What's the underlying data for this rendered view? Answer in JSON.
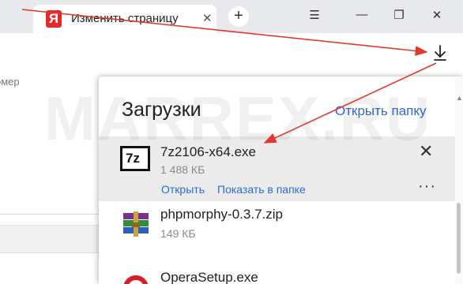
{
  "tab": {
    "title": "Изменить страницу",
    "logo_letter": "Я",
    "close_glyph": "✕"
  },
  "window": {
    "new_tab_glyph": "+",
    "menu_glyph": "☰",
    "minimize_glyph": "—",
    "restore_glyph": "❐",
    "close_glyph": "✕"
  },
  "page": {
    "left_text": "омер",
    "watermark": "MARREX.RU"
  },
  "downloads": {
    "title": "Загрузки",
    "open_folder": "Открыть папку",
    "items": [
      {
        "name": "7z2106-x64.exe",
        "size": "1 488 КБ",
        "icon": "7z-icon",
        "icon_text": "7z",
        "actions": [
          "Открыть",
          "Показать в папке"
        ],
        "close_glyph": "✕",
        "more_glyph": "···"
      },
      {
        "name": "phpmorphy-0.3.7.zip",
        "size": "149 КБ",
        "icon": "winrar-archive-icon"
      },
      {
        "name": "OperaSetup.exe",
        "icon": "opera-icon"
      }
    ]
  },
  "colors": {
    "accent": "#2f6bd6",
    "arrow": "#e03a2f",
    "tab_logo": "#e8262c",
    "selected_row": "#ebebeb"
  }
}
